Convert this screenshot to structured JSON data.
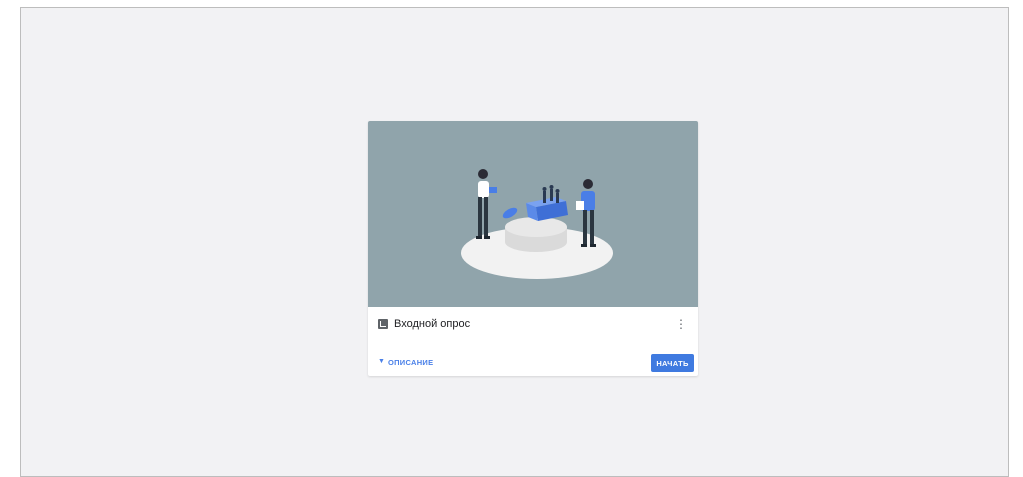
{
  "card": {
    "title": "Входной опрос",
    "description_toggle": "ОПИСАНИЕ",
    "start_button": "НАЧАТЬ",
    "more_icon": "more-vert-icon",
    "title_icon": "quiz-icon",
    "chevron_icon": "chevron-down-icon"
  },
  "colors": {
    "accent": "#3f7ae0",
    "image_background": "#90a4ab",
    "page_background": "#f2f2f4"
  }
}
